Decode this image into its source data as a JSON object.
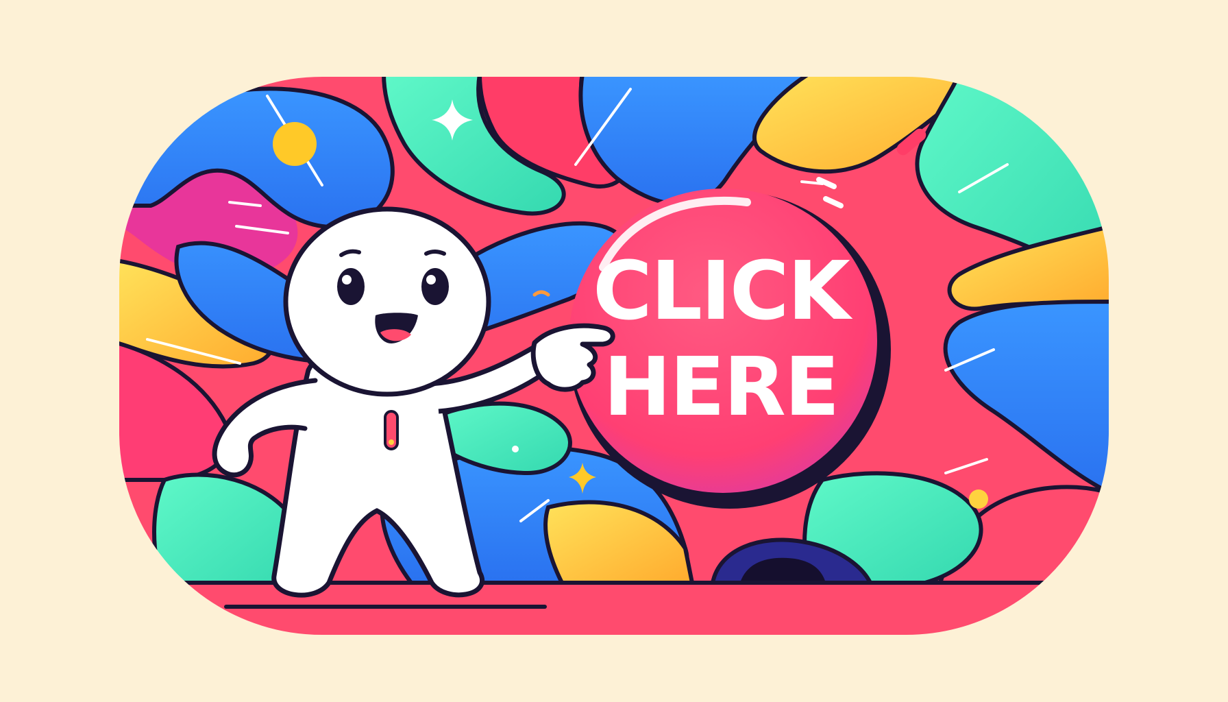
{
  "banner": {
    "button": {
      "line1": "CLICK",
      "line2": "HERE"
    }
  },
  "colors": {
    "background": "#fdf1d6",
    "outline": "#1a1433",
    "red": "#ff4b6e",
    "pink": "#ff3d74",
    "blue": "#2f8bff",
    "green": "#4df0c0",
    "yellow": "#ffd23f",
    "orange": "#ffa830",
    "magenta": "#c62fb0",
    "button_face": "#ff4a78",
    "character": "#ffffff"
  },
  "icons": [
    "sparkle-icon",
    "dot-icon",
    "pointing-hand-icon"
  ]
}
